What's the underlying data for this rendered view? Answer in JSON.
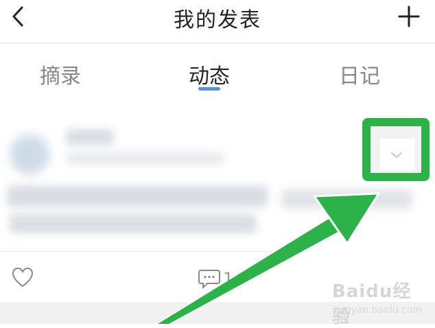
{
  "header": {
    "title": "我的发表",
    "back_icon": "chevron-left-icon",
    "add_icon": "plus-icon"
  },
  "tabs": [
    {
      "label": "摘录",
      "active": false
    },
    {
      "label": "动态",
      "active": true
    },
    {
      "label": "日记",
      "active": false
    }
  ],
  "post": {
    "more_icon": "chevron-down-icon",
    "like_icon": "heart-icon",
    "comment_icon": "comment-icon",
    "comment_count": "1"
  },
  "annotation": {
    "highlight_color": "#2db24a"
  },
  "watermark": {
    "logo": "Baidu经验",
    "sub": "jingyan.baidu.com"
  }
}
